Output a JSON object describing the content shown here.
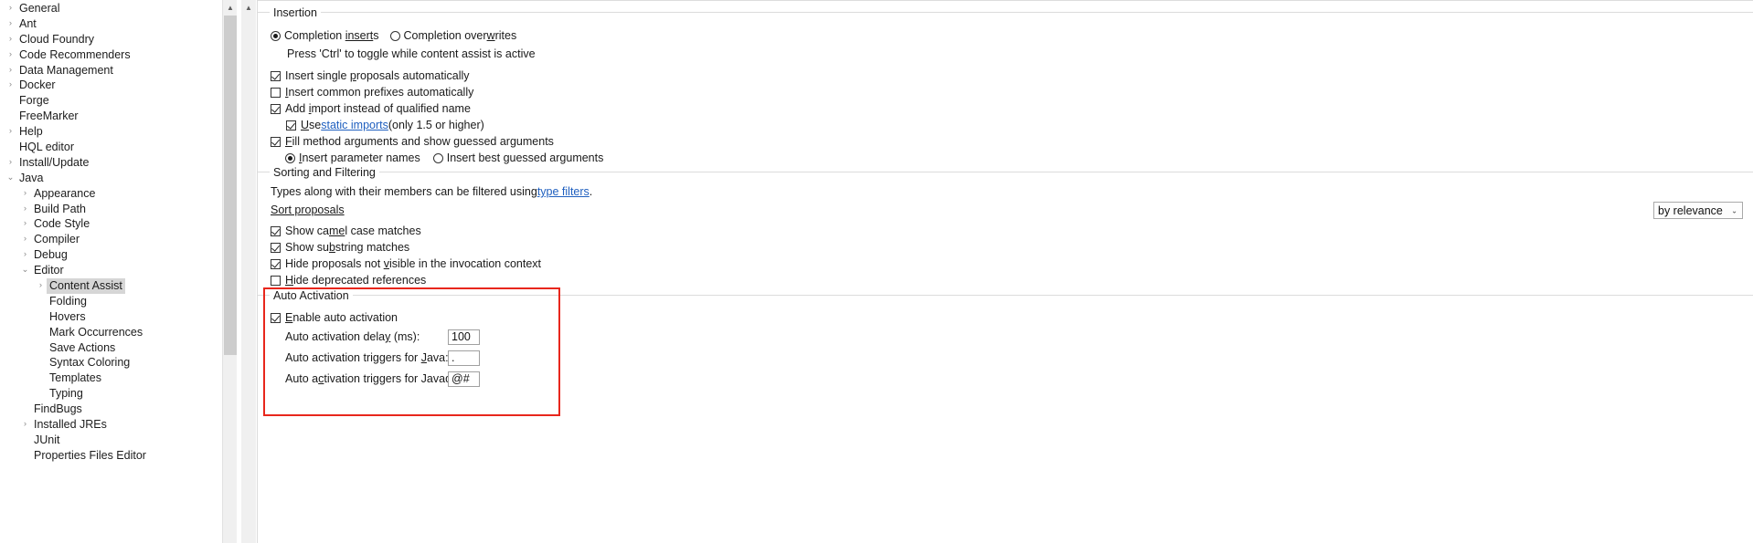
{
  "sidebar": {
    "name": "preferences-tree",
    "items": [
      {
        "label": "General",
        "indent": 0,
        "twisty": "collapsed",
        "selected": false
      },
      {
        "label": "Ant",
        "indent": 0,
        "twisty": "collapsed",
        "selected": false
      },
      {
        "label": "Cloud Foundry",
        "indent": 0,
        "twisty": "collapsed",
        "selected": false
      },
      {
        "label": "Code Recommenders",
        "indent": 0,
        "twisty": "collapsed",
        "selected": false
      },
      {
        "label": "Data Management",
        "indent": 0,
        "twisty": "collapsed",
        "selected": false
      },
      {
        "label": "Docker",
        "indent": 0,
        "twisty": "collapsed",
        "selected": false
      },
      {
        "label": "Forge",
        "indent": 0,
        "twisty": "none",
        "selected": false
      },
      {
        "label": "FreeMarker",
        "indent": 0,
        "twisty": "none",
        "selected": false
      },
      {
        "label": "Help",
        "indent": 0,
        "twisty": "collapsed",
        "selected": false
      },
      {
        "label": "HQL editor",
        "indent": 0,
        "twisty": "none",
        "selected": false
      },
      {
        "label": "Install/Update",
        "indent": 0,
        "twisty": "collapsed",
        "selected": false
      },
      {
        "label": "Java",
        "indent": 0,
        "twisty": "expanded",
        "selected": false
      },
      {
        "label": "Appearance",
        "indent": 1,
        "twisty": "collapsed",
        "selected": false
      },
      {
        "label": "Build Path",
        "indent": 1,
        "twisty": "collapsed",
        "selected": false
      },
      {
        "label": "Code Style",
        "indent": 1,
        "twisty": "collapsed",
        "selected": false
      },
      {
        "label": "Compiler",
        "indent": 1,
        "twisty": "collapsed",
        "selected": false
      },
      {
        "label": "Debug",
        "indent": 1,
        "twisty": "collapsed",
        "selected": false
      },
      {
        "label": "Editor",
        "indent": 1,
        "twisty": "expanded",
        "selected": false
      },
      {
        "label": "Content Assist",
        "indent": 2,
        "twisty": "collapsed",
        "selected": true
      },
      {
        "label": "Folding",
        "indent": 2,
        "twisty": "none",
        "selected": false
      },
      {
        "label": "Hovers",
        "indent": 2,
        "twisty": "none",
        "selected": false
      },
      {
        "label": "Mark Occurrences",
        "indent": 2,
        "twisty": "none",
        "selected": false
      },
      {
        "label": "Save Actions",
        "indent": 2,
        "twisty": "none",
        "selected": false
      },
      {
        "label": "Syntax Coloring",
        "indent": 2,
        "twisty": "none",
        "selected": false
      },
      {
        "label": "Templates",
        "indent": 2,
        "twisty": "none",
        "selected": false
      },
      {
        "label": "Typing",
        "indent": 2,
        "twisty": "none",
        "selected": false
      },
      {
        "label": "FindBugs",
        "indent": 1,
        "twisty": "none",
        "selected": false
      },
      {
        "label": "Installed JREs",
        "indent": 1,
        "twisty": "collapsed",
        "selected": false
      },
      {
        "label": "JUnit",
        "indent": 1,
        "twisty": "none",
        "selected": false
      },
      {
        "label": "Properties Files Editor",
        "indent": 1,
        "twisty": "none",
        "selected": false
      }
    ]
  },
  "insertion": {
    "title": "Insertion",
    "radio_inserts": "Completion inserts",
    "radio_overwrites": "Completion overwrites",
    "radio_selected": "inserts",
    "hint": "Press 'Ctrl' to toggle while content assist is active",
    "cb_single_proposals": "Insert single proposals automatically",
    "cb_single_proposals_checked": true,
    "cb_common_prefixes": "Insert common prefixes automatically",
    "cb_common_prefixes_checked": false,
    "cb_add_import": "Add import instead of qualified name",
    "cb_add_import_checked": true,
    "cb_static_imports_pre": "Use ",
    "cb_static_imports_link": "static imports",
    "cb_static_imports_post": " (only 1.5 or higher)",
    "cb_static_imports_checked": true,
    "cb_fill_args": "Fill method arguments and show guessed arguments",
    "cb_fill_args_checked": true,
    "radio_param_names": "Insert parameter names",
    "radio_best_guessed": "Insert best guessed arguments",
    "radio_args_selected": "param_names"
  },
  "sorting": {
    "title": "Sorting and Filtering",
    "filter_text_pre": "Types along with their members can be filtered using ",
    "filter_link": "type filters",
    "filter_text_post": ".",
    "sort_proposals_label": "Sort proposals",
    "sort_combo_value": "by relevance",
    "cb_camel_case": "Show camel case matches",
    "cb_camel_case_checked": true,
    "cb_substring": "Show substring matches",
    "cb_substring_checked": true,
    "cb_hide_not_visible": "Hide proposals not visible in the invocation context",
    "cb_hide_not_visible_checked": true,
    "cb_hide_deprecated": "Hide deprecated references",
    "cb_hide_deprecated_checked": false
  },
  "auto_activation": {
    "title": "Auto Activation",
    "cb_enable": "Enable auto activation",
    "cb_enable_checked": true,
    "delay_label": "Auto activation delay (ms):",
    "delay_value": "100",
    "java_label": "Auto activation triggers for Java:",
    "java_value": ".",
    "javadoc_label": "Auto activation triggers for Javadoc:",
    "javadoc_value": "@#",
    "highlight_color": "#e8271c"
  },
  "icons": {
    "twisty_collapsed": "›",
    "twisty_expanded": "⌄",
    "scroll_up": "▲",
    "scroll_down": "▼",
    "combo_caret": "⌄"
  }
}
